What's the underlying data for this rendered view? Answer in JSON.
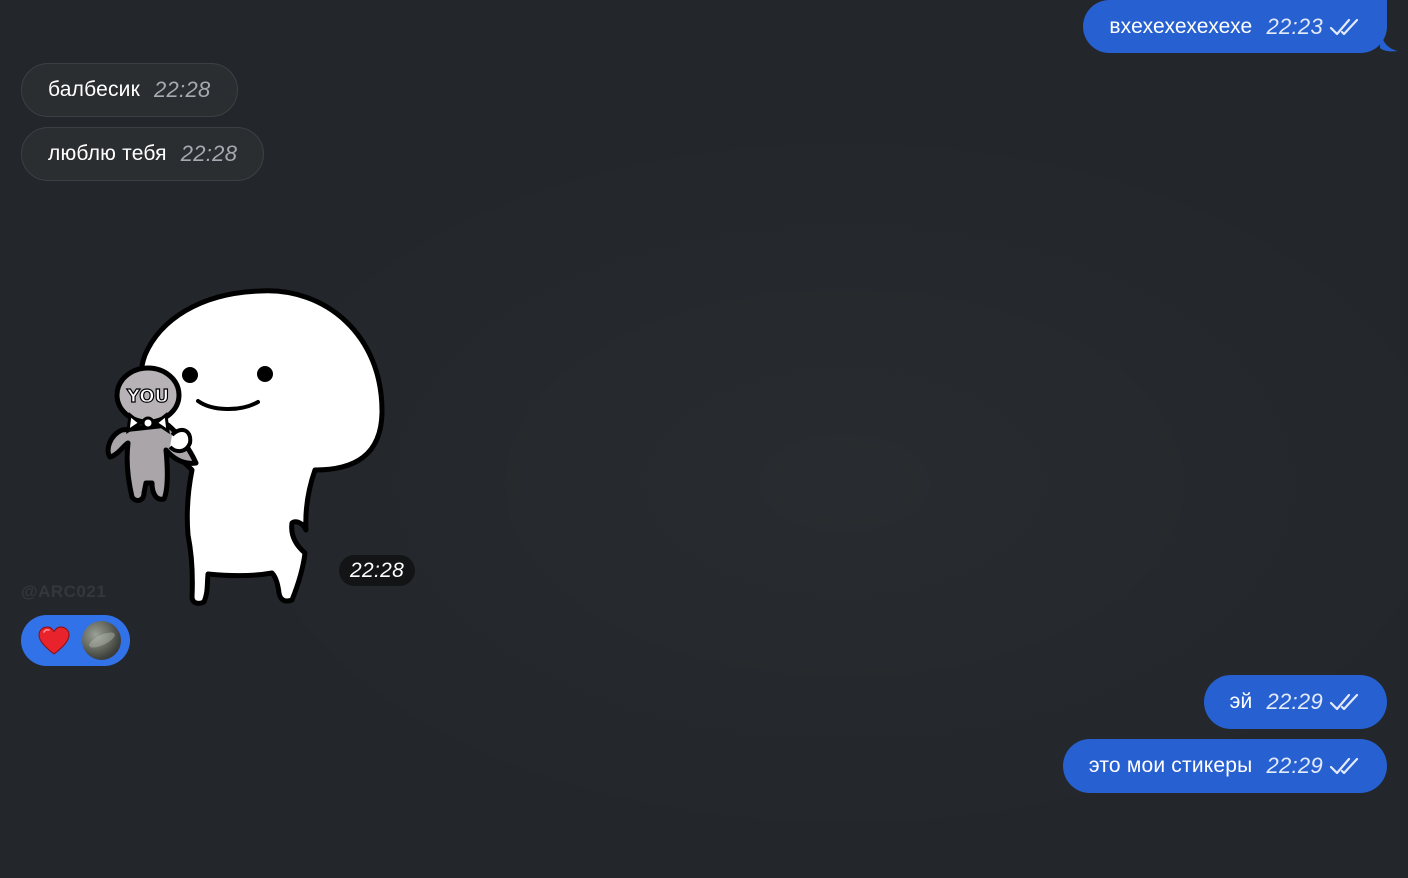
{
  "messages": [
    {
      "direction": "out",
      "text": "вхехехехехехе",
      "time": "22:23",
      "read": true
    },
    {
      "direction": "in",
      "text": "балбесик",
      "time": "22:28"
    },
    {
      "direction": "in",
      "text": "люблю тебя",
      "time": "22:28"
    },
    {
      "direction": "in",
      "type": "sticker",
      "sticker_text": "YOU",
      "time": "22:28",
      "watermark": "@ARC021"
    },
    {
      "direction": "out",
      "text": "эй",
      "time": "22:29",
      "read": true
    },
    {
      "direction": "out",
      "text": "это мои стикеры",
      "time": "22:29",
      "read": true
    }
  ],
  "reaction": {
    "emoji": "❤️",
    "icon": "heart-icon"
  },
  "colors": {
    "background": "#23272b",
    "incoming_bubble": "#2b2e31",
    "outgoing_bubble": "#2760d0",
    "reaction_pill": "#3272e9"
  }
}
